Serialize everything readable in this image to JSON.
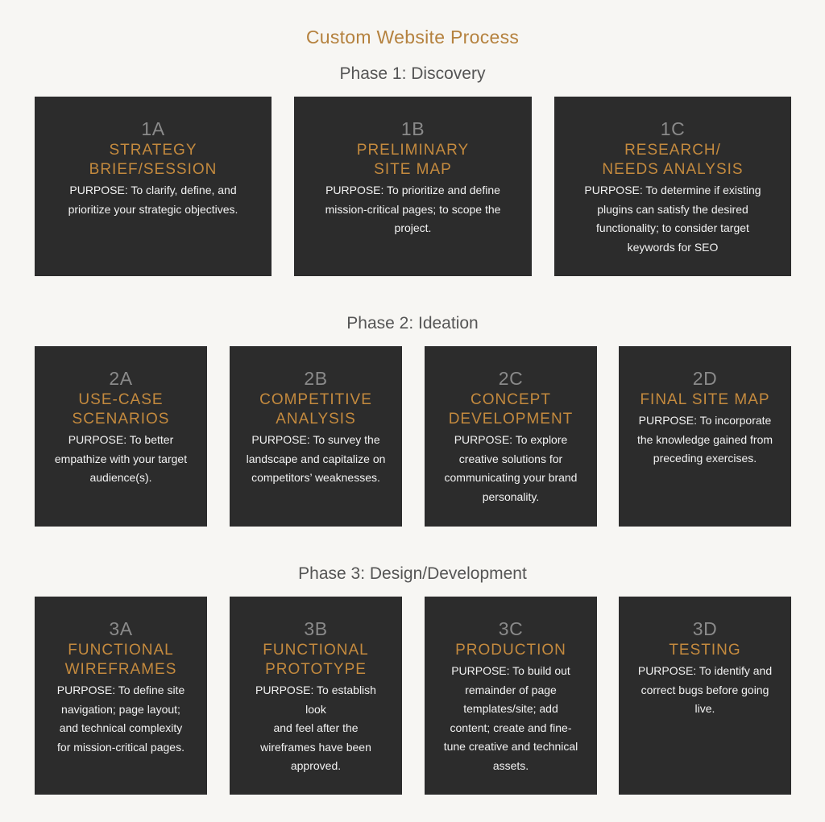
{
  "title": "Custom Website Process",
  "phases": [
    {
      "title": "Phase 1: Discovery",
      "steps": [
        {
          "code": "1A",
          "title": "STRATEGY BRIEF/SESSION",
          "purpose": "PURPOSE: To clarify, define, and\nprioritize your strategic objectives."
        },
        {
          "code": "1B",
          "title": "PRELIMINARY\nSITE MAP",
          "purpose": "PURPOSE: To prioritize and define\nmission-critical pages; to scope the\nproject."
        },
        {
          "code": "1C",
          "title": "RESEARCH/\nNEEDS ANALYSIS",
          "purpose": "PURPOSE: To determine if existing\nplugins can satisfy the desired\nfunctionality; to consider target\nkeywords for SEO"
        }
      ]
    },
    {
      "title": "Phase 2: Ideation",
      "steps": [
        {
          "code": "2A",
          "title": "USE-CASE\nSCENARIOS",
          "purpose": "PURPOSE: To better\nempathize with your target\naudience(s)."
        },
        {
          "code": "2B",
          "title": "COMPETITIVE\nANALYSIS",
          "purpose": "PURPOSE: To survey the\nlandscape and capitalize on\ncompetitors’ weaknesses."
        },
        {
          "code": "2C",
          "title": "CONCEPT\nDEVELOPMENT",
          "purpose": "PURPOSE: To explore\ncreative solutions for\ncommunicating your brand\npersonality."
        },
        {
          "code": "2D",
          "title": "FINAL SITE MAP",
          "purpose": "PURPOSE: To incorporate\nthe knowledge gained from\npreceding exercises."
        }
      ]
    },
    {
      "title": "Phase 3: Design/Development",
      "steps": [
        {
          "code": "3A",
          "title": "FUNCTIONAL\nWIREFRAMES",
          "purpose": "PURPOSE: To define site\nnavigation; page layout;\nand technical complexity\nfor mission-critical pages."
        },
        {
          "code": "3B",
          "title": "FUNCTIONAL\nPROTOTYPE",
          "purpose": "PURPOSE: To establish look\nand feel after the\nwireframes have been\napproved."
        },
        {
          "code": "3C",
          "title": "PRODUCTION",
          "purpose": "PURPOSE: To build out\nremainder of page\ntemplates/site; add\ncontent; create and fine-\ntune creative and technical\nassets."
        },
        {
          "code": "3D",
          "title": "TESTING",
          "purpose": "PURPOSE: To identify and\ncorrect bugs before going\nlive."
        }
      ]
    }
  ]
}
